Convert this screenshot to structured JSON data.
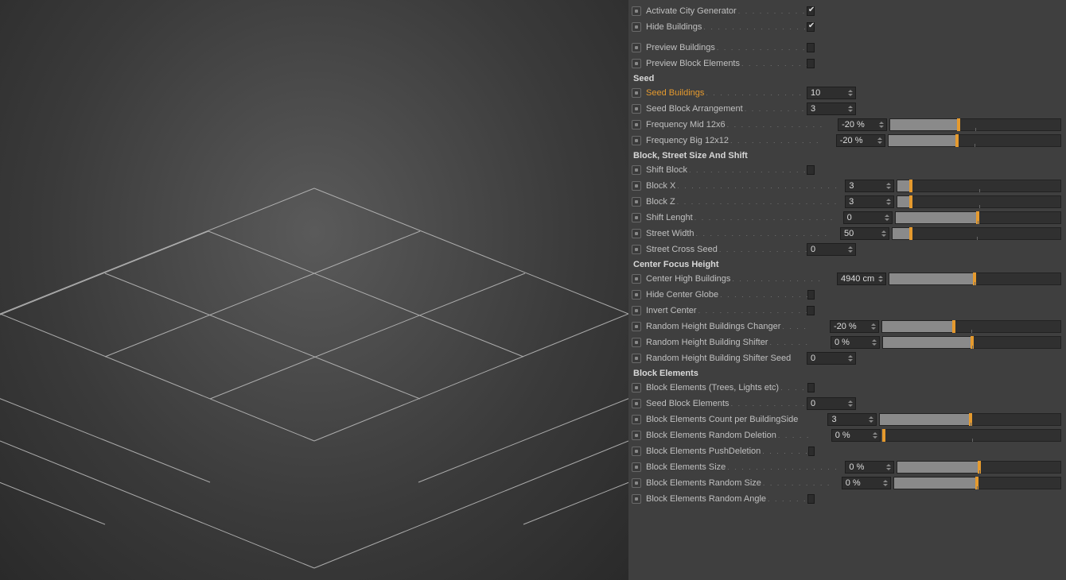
{
  "top": {
    "activate": {
      "label": "Activate City Generator",
      "checked": true
    },
    "hide": {
      "label": "Hide Buildings",
      "checked": true
    },
    "previewBuildings": {
      "label": "Preview Buildings",
      "checked": false
    },
    "previewBlockElements": {
      "label": "Preview Block Elements",
      "checked": false
    }
  },
  "sections": {
    "seed": {
      "title": "Seed",
      "seedBuildings": {
        "label": "Seed Buildings",
        "value": "10",
        "highlighted": true
      },
      "seedBlockArrangement": {
        "label": "Seed Block Arrangement",
        "value": "3"
      },
      "freqMid": {
        "label": "Frequency Mid 12x6",
        "value": "-20 %",
        "fill": 40
      },
      "freqBig": {
        "label": "Frequency Big 12x12",
        "value": "-20 %",
        "fill": 40
      }
    },
    "block": {
      "title": "Block, Street Size And Shift",
      "shiftBlock": {
        "label": "Shift Block",
        "checked": false
      },
      "blockX": {
        "label": "Block X",
        "value": "3",
        "fill": 8
      },
      "blockZ": {
        "label": "Block Z",
        "value": "3",
        "fill": 8
      },
      "shiftLength": {
        "label": "Shift Lenght",
        "value": "0",
        "fill": 50
      },
      "streetWidth": {
        "label": "Street Width",
        "value": "50",
        "fill": 11
      },
      "streetCrossSeed": {
        "label": "Street Cross Seed",
        "value": "0"
      }
    },
    "center": {
      "title": "Center Focus Height",
      "centerHigh": {
        "label": "Center High Buildings",
        "value": "4940 cm",
        "fill": 50
      },
      "hideGlobe": {
        "label": "Hide Center Globe",
        "checked": false
      },
      "invertCenter": {
        "label": "Invert Center",
        "checked": false
      },
      "randHeightChanger": {
        "label": "Random Height Buildings Changer",
        "value": "-20 %",
        "fill": 40
      },
      "randHeightShifter": {
        "label": "Random Height Building Shifter",
        "value": "0 %",
        "fill": 50
      },
      "randHeightShifterSeed": {
        "label": "Random Height Building Shifter Seed",
        "value": "0"
      }
    },
    "elements": {
      "title": "Block Elements",
      "enable": {
        "label": "Block Elements (Trees, Lights etc)",
        "checked": false
      },
      "seed": {
        "label": "Seed Block Elements",
        "value": "0"
      },
      "countPerSide": {
        "label": "Block Elements Count per BuildingSide",
        "value": "3",
        "fill": 50
      },
      "randDeletion": {
        "label": "Block Elements Random Deletion",
        "value": "0 %",
        "fill": 0
      },
      "pushDeletion": {
        "label": "Block Elements PushDeletion",
        "checked": false
      },
      "size": {
        "label": "Block Elements Size",
        "value": "0 %",
        "fill": 50
      },
      "randSize": {
        "label": "Block Elements Random Size",
        "value": "0 %",
        "fill": 50
      },
      "randAngle": {
        "label": "Block Elements Random Angle",
        "checked": false
      }
    }
  }
}
